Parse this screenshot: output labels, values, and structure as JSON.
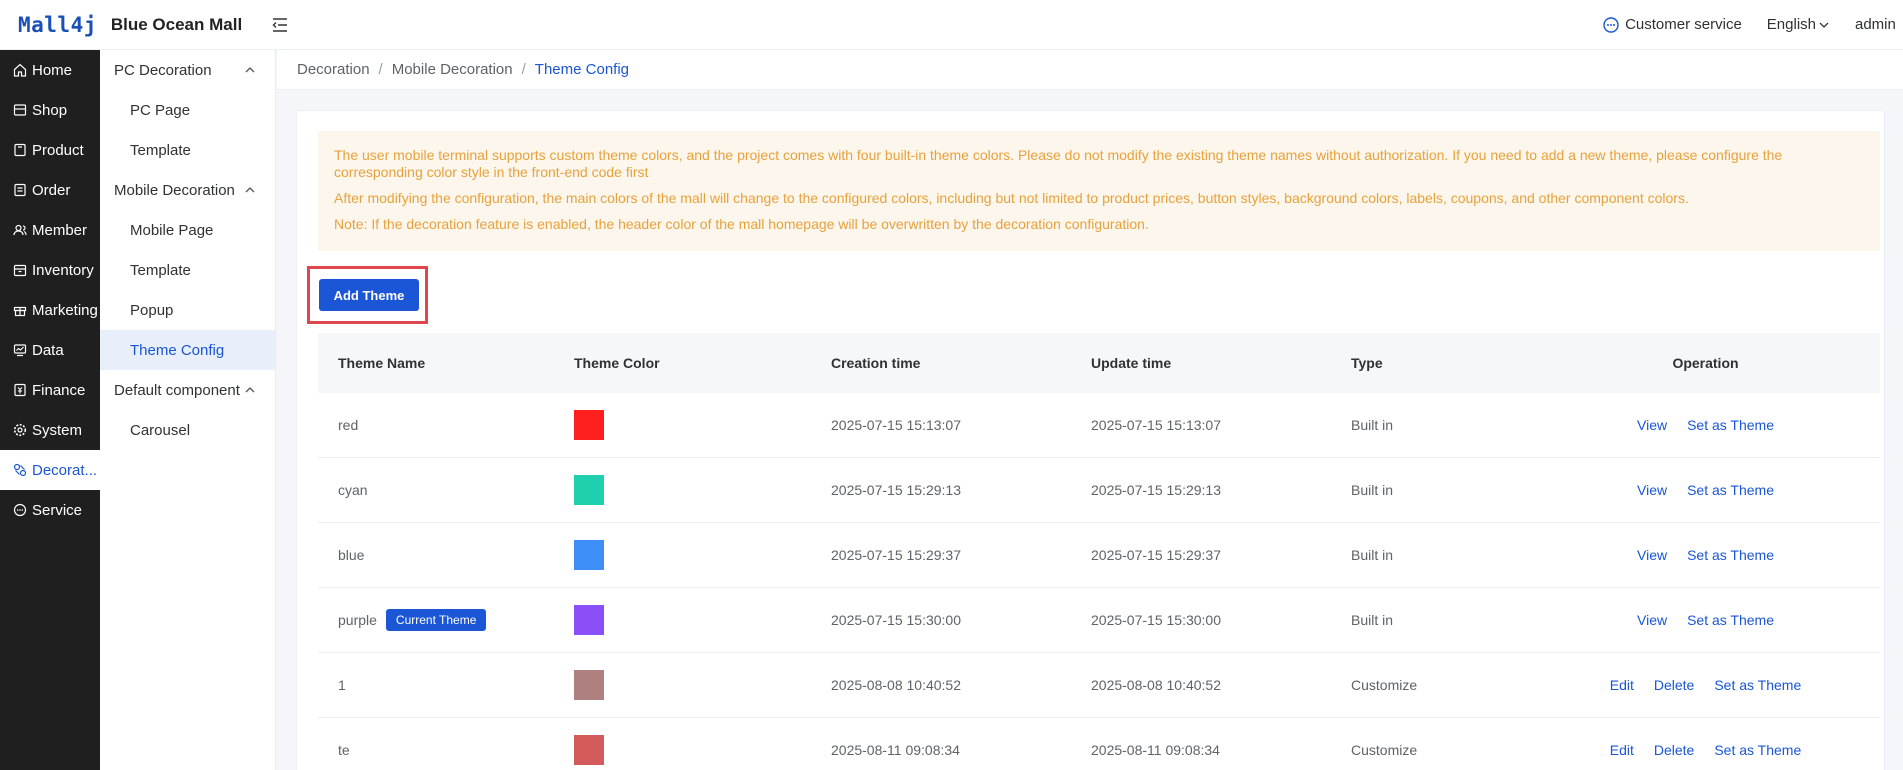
{
  "header": {
    "logo_mark": "Mall4j",
    "brand": "Blue Ocean Mall",
    "customer_service": "Customer service",
    "language": "English",
    "user": "admin"
  },
  "nav": [
    {
      "label": "Home",
      "icon": "home-icon"
    },
    {
      "label": "Shop",
      "icon": "shop-icon"
    },
    {
      "label": "Product",
      "icon": "product-icon"
    },
    {
      "label": "Order",
      "icon": "order-icon"
    },
    {
      "label": "Member",
      "icon": "member-icon"
    },
    {
      "label": "Inventory",
      "icon": "inventory-icon"
    },
    {
      "label": "Marketing",
      "icon": "gift-icon"
    },
    {
      "label": "Data",
      "icon": "data-icon"
    },
    {
      "label": "Finance",
      "icon": "finance-icon"
    },
    {
      "label": "System",
      "icon": "gear-icon"
    },
    {
      "label": "Decorat...",
      "icon": "decoration-icon"
    },
    {
      "label": "Service",
      "icon": "chat-icon"
    }
  ],
  "subnav": {
    "group1": "PC Decoration",
    "group1_items": [
      "PC Page",
      "Template"
    ],
    "group2": "Mobile Decoration",
    "group2_items": [
      "Mobile Page",
      "Template",
      "Popup",
      "Theme Config"
    ],
    "group3": "Default component",
    "group3_items": [
      "Carousel"
    ]
  },
  "breadcrumb": [
    "Decoration",
    "Mobile Decoration",
    "Theme Config"
  ],
  "notice": [
    "The user mobile terminal supports custom theme colors, and the project comes with four built-in theme colors. Please do not modify the existing theme names without authorization. If you need to add a new theme, please configure the corresponding color style in the front-end code first",
    "After modifying the configuration, the main colors of the mall will change to the configured colors, including but not limited to product prices, button styles, background colors, labels, coupons, and other component colors.",
    "Note: If the decoration feature is enabled, the header color of the mall homepage will be overwritten by the decoration configuration."
  ],
  "add_button": "Add Theme",
  "table": {
    "headers": [
      "Theme Name",
      "Theme Color",
      "Creation time",
      "Update time",
      "Type",
      "Operation"
    ],
    "current_badge": "Current Theme",
    "rows": [
      {
        "name": "red",
        "color": "#ff1f1f",
        "created": "2025-07-15 15:13:07",
        "updated": "2025-07-15 15:13:07",
        "type": "Built in",
        "ops": [
          "View",
          "Set as Theme"
        ]
      },
      {
        "name": "cyan",
        "color": "#1fcfad",
        "created": "2025-07-15 15:29:13",
        "updated": "2025-07-15 15:29:13",
        "type": "Built in",
        "ops": [
          "View",
          "Set as Theme"
        ]
      },
      {
        "name": "blue",
        "color": "#3d8ef7",
        "created": "2025-07-15 15:29:37",
        "updated": "2025-07-15 15:29:37",
        "type": "Built in",
        "ops": [
          "View",
          "Set as Theme"
        ]
      },
      {
        "name": "purple",
        "color": "#8a4ff6",
        "created": "2025-07-15 15:30:00",
        "updated": "2025-07-15 15:30:00",
        "type": "Built in",
        "ops": [
          "View",
          "Set as Theme"
        ],
        "current": true
      },
      {
        "name": "1",
        "color": "#b08080",
        "created": "2025-08-08 10:40:52",
        "updated": "2025-08-08 10:40:52",
        "type": "Customize",
        "ops": [
          "Edit",
          "Delete",
          "Set as Theme"
        ]
      },
      {
        "name": "te",
        "color": "#d45b5b",
        "created": "2025-08-11 09:08:34",
        "updated": "2025-08-11 09:08:34",
        "type": "Customize",
        "ops": [
          "Edit",
          "Delete",
          "Set as Theme"
        ]
      }
    ]
  }
}
